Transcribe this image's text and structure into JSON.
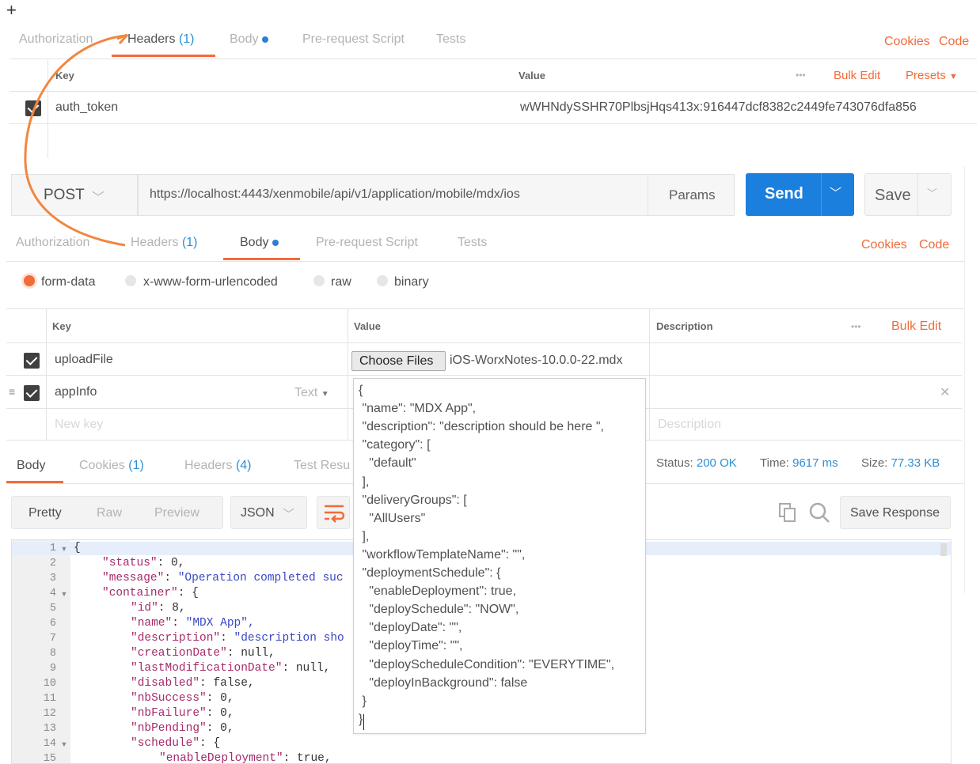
{
  "corner_plus": "+",
  "top_tabs": {
    "authorization": "Authorization",
    "headers": "Headers",
    "headers_count": "(1)",
    "body": "Body",
    "prerequest": "Pre-request Script",
    "tests": "Tests",
    "cookies": "Cookies",
    "code": "Code"
  },
  "top_headers_table": {
    "key_col": "Key",
    "value_col": "Value",
    "more": "•••",
    "bulk_edit": "Bulk Edit",
    "presets": "Presets",
    "row": {
      "key": "auth_token",
      "value": "wWHNdySSHR70PlbsjHqs413x:916447dcf8382c2449fe743076dfa856"
    }
  },
  "request": {
    "method": "POST",
    "url": "https://localhost:4443/xenmobile/api/v1/application/mobile/mdx/ios",
    "params": "Params",
    "send": "Send",
    "save": "Save"
  },
  "tabs2": {
    "authorization": "Authorization",
    "headers": "Headers",
    "headers_count": "(1)",
    "body": "Body",
    "prerequest": "Pre-request Script",
    "tests": "Tests",
    "cookies": "Cookies",
    "code": "Code"
  },
  "body_modes": {
    "form_data": "form-data",
    "urlencoded": "x-www-form-urlencoded",
    "raw": "raw",
    "binary": "binary"
  },
  "form_table": {
    "key_col": "Key",
    "value_col": "Value",
    "desc_col": "Description",
    "more": "•••",
    "bulk_edit": "Bulk Edit",
    "row1_key": "uploadFile",
    "choose_files": "Choose Files",
    "file_name": "iOS-WorxNotes-10.0.0-22.mdx",
    "row2_key": "appInfo",
    "row2_type": "Text",
    "new_key": "New key",
    "new_desc": "Description",
    "remove": "✕"
  },
  "json_popup": [
    "{",
    " \"name\": \"MDX App\",",
    " \"description\": \"description should be here \",",
    " \"category\": [",
    "   \"default\"",
    " ],",
    " \"deliveryGroups\": [",
    "   \"AllUsers\"",
    " ],",
    " \"workflowTemplateName\": \"\",",
    " \"deploymentSchedule\": {",
    "   \"enableDeployment\": true,",
    "   \"deploySchedule\": \"NOW\",",
    "   \"deployDate\": \"\",",
    "   \"deployTime\": \"\",",
    "   \"deployScheduleCondition\": \"EVERYTIME\",",
    "   \"deployInBackground\": false",
    " }",
    "}"
  ],
  "response_tabs": {
    "body": "Body",
    "cookies": "Cookies",
    "cookies_count": "(1)",
    "headers": "Headers",
    "headers_count": "(4)",
    "test_results": "Test Resu",
    "status_label": "Status:",
    "status_value": "200 OK",
    "time_label": "Time:",
    "time_value": "9617 ms",
    "size_label": "Size:",
    "size_value": "77.33 KB"
  },
  "response_toolbar": {
    "pretty": "Pretty",
    "raw": "Raw",
    "preview": "Preview",
    "format": "JSON",
    "save_response": "Save Response"
  },
  "response_lines": [
    {
      "num": "1",
      "fold": "▾",
      "text": "{"
    },
    {
      "num": "2",
      "key": "\"status\"",
      "rest": ": 0,"
    },
    {
      "num": "3",
      "key": "\"message\"",
      "rest": ": ",
      "str": "\"Operation completed suc"
    },
    {
      "num": "4",
      "fold": "▾",
      "key": "\"container\"",
      "rest": ": {"
    },
    {
      "num": "5",
      "key": "\"id\"",
      "rest": ": 8,",
      "indent": 2
    },
    {
      "num": "6",
      "key": "\"name\"",
      "rest": ": ",
      "str": "\"MDX App\",",
      "indent": 2
    },
    {
      "num": "7",
      "key": "\"description\"",
      "rest": ": ",
      "str": "\"description sho",
      "indent": 2
    },
    {
      "num": "8",
      "key": "\"creationDate\"",
      "rest": ": null,",
      "indent": 2
    },
    {
      "num": "9",
      "key": "\"lastModificationDate\"",
      "rest": ": null,",
      "indent": 2
    },
    {
      "num": "10",
      "key": "\"disabled\"",
      "rest": ": false,",
      "indent": 2
    },
    {
      "num": "11",
      "key": "\"nbSuccess\"",
      "rest": ": 0,",
      "indent": 2
    },
    {
      "num": "12",
      "key": "\"nbFailure\"",
      "rest": ": 0,",
      "indent": 2
    },
    {
      "num": "13",
      "key": "\"nbPending\"",
      "rest": ": 0,",
      "indent": 2
    },
    {
      "num": "14",
      "fold": "▾",
      "key": "\"schedule\"",
      "rest": ": {",
      "indent": 2
    },
    {
      "num": "15",
      "key": "\"enableDeployment\"",
      "rest": ": true,",
      "indent": 3
    }
  ],
  "colors": {
    "accent": "#f26b3a",
    "send_blue": "#1a7fdd",
    "link_blue": "#2d8fd5",
    "status_green_text": "#2d8fd5"
  }
}
